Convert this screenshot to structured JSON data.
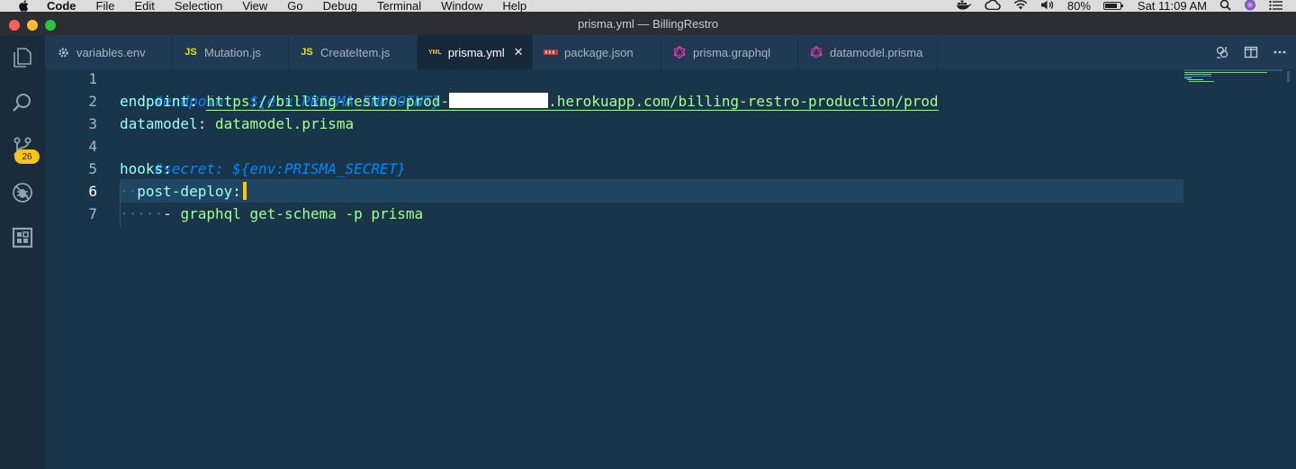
{
  "menubar": {
    "items": [
      "Code",
      "File",
      "Edit",
      "Selection",
      "View",
      "Go",
      "Debug",
      "Terminal",
      "Window",
      "Help"
    ],
    "battery_percent": "80%",
    "battery_level": 0.8,
    "clock": "Sat 11:09 AM"
  },
  "window": {
    "title": "prisma.yml — BillingRestro"
  },
  "activitybar": {
    "scm_badge": "26"
  },
  "tabs": [
    {
      "label": "variables.env",
      "icon": "gear-icon",
      "active": false
    },
    {
      "label": "Mutation.js",
      "icon": "js-icon",
      "active": false
    },
    {
      "label": "CreateItem.js",
      "icon": "js-icon",
      "active": false
    },
    {
      "label": "prisma.yml",
      "icon": "yml-icon",
      "active": true
    },
    {
      "label": "package.json",
      "icon": "npm-icon",
      "active": false
    },
    {
      "label": "prisma.graphql",
      "icon": "graphql-icon",
      "active": false
    },
    {
      "label": "datamodel.prisma",
      "icon": "prisma-icon",
      "active": false
    }
  ],
  "editor": {
    "line_numbers": [
      "1",
      "2",
      "3",
      "4",
      "5",
      "6",
      "7"
    ],
    "active_line": 6,
    "lines": {
      "l1": "#endpoint: ${env:PRISMA_ENDPOINT}",
      "l2_key": "endpoint",
      "l2_colon": ":",
      "l2_url_start": "https://billing-restro-prod-",
      "l2_url_end": ".herokuapp.com/billing-restro-production/prod",
      "l3_key": "datamodel",
      "l3_colon": ":",
      "l3_val": "datamodel.prisma",
      "l4": "#secret: ${env:PRISMA_SECRET}",
      "l5_key": "hooks",
      "l5_colon": ":",
      "l6_key": "post-deploy",
      "l6_colon": ":",
      "l7_dash": "-",
      "l7_val": "graphql get-schema -p prisma"
    }
  },
  "colors": {
    "editor_bg": "#193549",
    "comment": "#0088ff",
    "key": "#9efff5",
    "string": "#a5ff90",
    "cursor": "#ffc600",
    "badge": "#f8c31d"
  }
}
